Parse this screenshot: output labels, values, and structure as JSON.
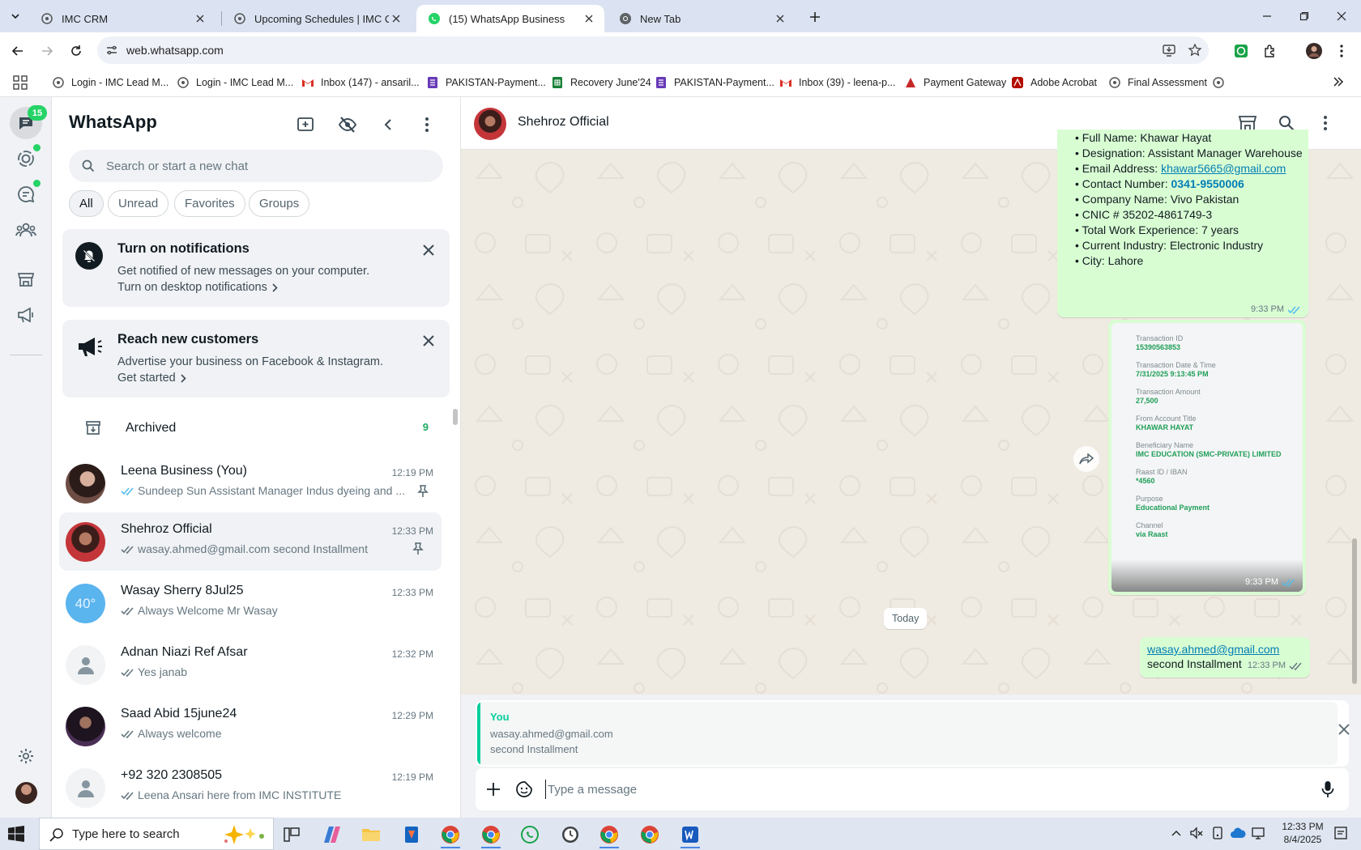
{
  "browser": {
    "tabs": [
      {
        "title": "IMC CRM"
      },
      {
        "title": "Upcoming Schedules | IMC Cert"
      },
      {
        "title": "(15) WhatsApp Business"
      },
      {
        "title": "New Tab"
      }
    ],
    "active_tab": 2,
    "url": "web.whatsapp.com",
    "bookmarks": [
      {
        "label": "Login - IMC Lead M..."
      },
      {
        "label": "Login - IMC Lead M..."
      },
      {
        "label": "Inbox (147) - ansaril..."
      },
      {
        "label": "PAKISTAN-Payment..."
      },
      {
        "label": "Recovery June'24"
      },
      {
        "label": "PAKISTAN-Payment..."
      },
      {
        "label": "Inbox (39) - leena-p..."
      },
      {
        "label": "Payment Gateway"
      },
      {
        "label": "Adobe Acrobat"
      },
      {
        "label": "Final Assessment"
      }
    ]
  },
  "rail": {
    "chats_badge": "15"
  },
  "sidebar": {
    "title": "WhatsApp",
    "search_placeholder": "Search or start a new chat",
    "filters": [
      "All",
      "Unread",
      "Favorites",
      "Groups"
    ],
    "notif_card": {
      "title": "Turn on notifications",
      "subtitle": "Get notified of new messages on your computer.",
      "link": "Turn on desktop notifications"
    },
    "reach_card": {
      "title": "Reach new customers",
      "subtitle": "Advertise your business on Facebook & Instagram.",
      "link": "Get started"
    },
    "archived": {
      "label": "Archived",
      "count": "9"
    },
    "chats": [
      {
        "name": "Leena Business (You)",
        "time": "12:19 PM",
        "preview": "Sundeep Sun Assistant Manager Indus dyeing and ...",
        "tick_color": "#53bdeb",
        "pinned": true,
        "avatar": "photo-woman"
      },
      {
        "name": "Shehroz Official",
        "time": "12:33 PM",
        "preview": "wasay.ahmed@gmail.com second Installment",
        "tick_color": "#667781",
        "pinned": true,
        "avatar": "photo-man"
      },
      {
        "name": "Wasay Sherry 8Jul25",
        "time": "12:33 PM",
        "preview": "Always Welcome Mr Wasay",
        "tick_color": "#667781",
        "pinned": false,
        "avatar": "weather-40"
      },
      {
        "name": "Adnan Niazi Ref Afsar",
        "time": "12:32 PM",
        "preview": "Yes janab",
        "tick_color": "#667781",
        "pinned": false,
        "avatar": "default"
      },
      {
        "name": "Saad Abid 15june24",
        "time": "12:29 PM",
        "preview": "Always welcome",
        "tick_color": "#667781",
        "pinned": false,
        "avatar": "photo-dark"
      },
      {
        "name": "+92 320 2308505",
        "time": "12:19 PM",
        "preview": "Leena Ansari here from IMC INSTITUTE",
        "tick_color": "#667781",
        "pinned": false,
        "avatar": "default"
      }
    ],
    "weather_avatar_text": "40°"
  },
  "conversation": {
    "contact_name": "Shehroz Official",
    "info_message": {
      "full_name": "• Full Name: Khawar Hayat",
      "designation": "• Designation: Assistant Manager Warehouse",
      "email_prefix": "• Email Address: ",
      "email": "khawar5665@gmail.com",
      "contact_prefix": "• Contact Number: ",
      "contact": "0341-9550006",
      "company": "• Company Name: Vivo Pakistan",
      "cnic": "• CNIC # 35202-4861749-3",
      "experience": "• Total Work Experience: 7 years",
      "industry": "• Current Industry: Electronic Industry",
      "city": "• City: Lahore",
      "time": "9:33 PM"
    },
    "receipt": {
      "fields": [
        {
          "label": "Transaction ID",
          "value": "15390563853"
        },
        {
          "label": "Transaction Date & Time",
          "value": "7/31/2025 9:13:45 PM"
        },
        {
          "label": "Transaction Amount",
          "value": "27,500"
        },
        {
          "label": "From Account Title",
          "value": "KHAWAR HAYAT"
        },
        {
          "label": "Beneficiary Name",
          "value": "IMC EDUCATION (SMC-PRIVATE) LIMITED"
        },
        {
          "label": "Raast ID / IBAN",
          "value": "*4560"
        },
        {
          "label": "Purpose",
          "value": "Educational Payment"
        },
        {
          "label": "Channel",
          "value": "via Raast"
        }
      ],
      "time": "9:33 PM"
    },
    "date_divider": "Today",
    "last_message": {
      "email": "wasay.ahmed@gmail.com",
      "text": "second Installment",
      "time": "12:33 PM"
    },
    "reply_preview": {
      "author": "You",
      "line1": "wasay.ahmed@gmail.com",
      "line2": "second Installment"
    },
    "composer_placeholder": "Type a message"
  },
  "taskbar": {
    "search_placeholder": "Type here to search",
    "time": "12:33 PM",
    "date": "8/4/2025"
  },
  "colors": {
    "whatsapp_green": "#25d366",
    "bubble_out": "#d9fdd3",
    "chat_bg": "#efeae2",
    "read_tick": "#53bdeb",
    "link": "#027eb5"
  }
}
